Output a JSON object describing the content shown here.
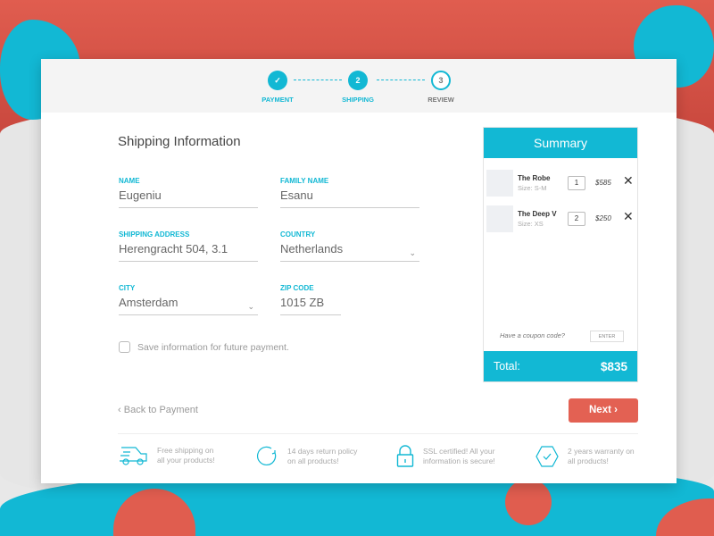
{
  "steps": [
    {
      "label": "PAYMENT",
      "mark": "✓",
      "state": "done"
    },
    {
      "label": "SHIPPING",
      "mark": "2",
      "state": "active"
    },
    {
      "label": "REVIEW",
      "mark": "3",
      "state": "todo"
    }
  ],
  "form": {
    "title": "Shipping Information",
    "name": {
      "label": "NAME",
      "value": "Eugeniu"
    },
    "family": {
      "label": "FAMILY NAME",
      "value": "Esanu"
    },
    "address": {
      "label": "SHIPPING ADDRESS",
      "value": "Herengracht 504, 3.1"
    },
    "country": {
      "label": "COUNTRY",
      "value": "Netherlands"
    },
    "city": {
      "label": "CITY",
      "value": "Amsterdam"
    },
    "zip": {
      "label": "ZIP CODE",
      "value": "1015 ZB"
    },
    "save": "Save information for future payment."
  },
  "nav": {
    "back": "Back to Payment",
    "next": "Next"
  },
  "summary": {
    "title": "Summary",
    "items": [
      {
        "name": "The Robe",
        "size": "Size: S-M",
        "qty": "1",
        "price": "$585"
      },
      {
        "name": "The Deep V",
        "size": "Size: XS",
        "qty": "2",
        "price": "$250"
      }
    ],
    "coupon": "Have a coupon code?",
    "enter": "ENTER",
    "total_label": "Total:",
    "total": "$835"
  },
  "features": [
    {
      "icon": "truck-icon",
      "l1": "Free shipping on",
      "l2": "all your products!"
    },
    {
      "icon": "return-icon",
      "l1": "14 days return policy",
      "l2": "on all products!"
    },
    {
      "icon": "lock-icon",
      "l1": "SSL certified! All your",
      "l2": "information is secure!"
    },
    {
      "icon": "shield-check-icon",
      "l1": "2 years warranty on",
      "l2": "all products!"
    }
  ],
  "colors": {
    "accent": "#12b8d4",
    "button": "#e36153",
    "background_top": "#e05d4f"
  }
}
